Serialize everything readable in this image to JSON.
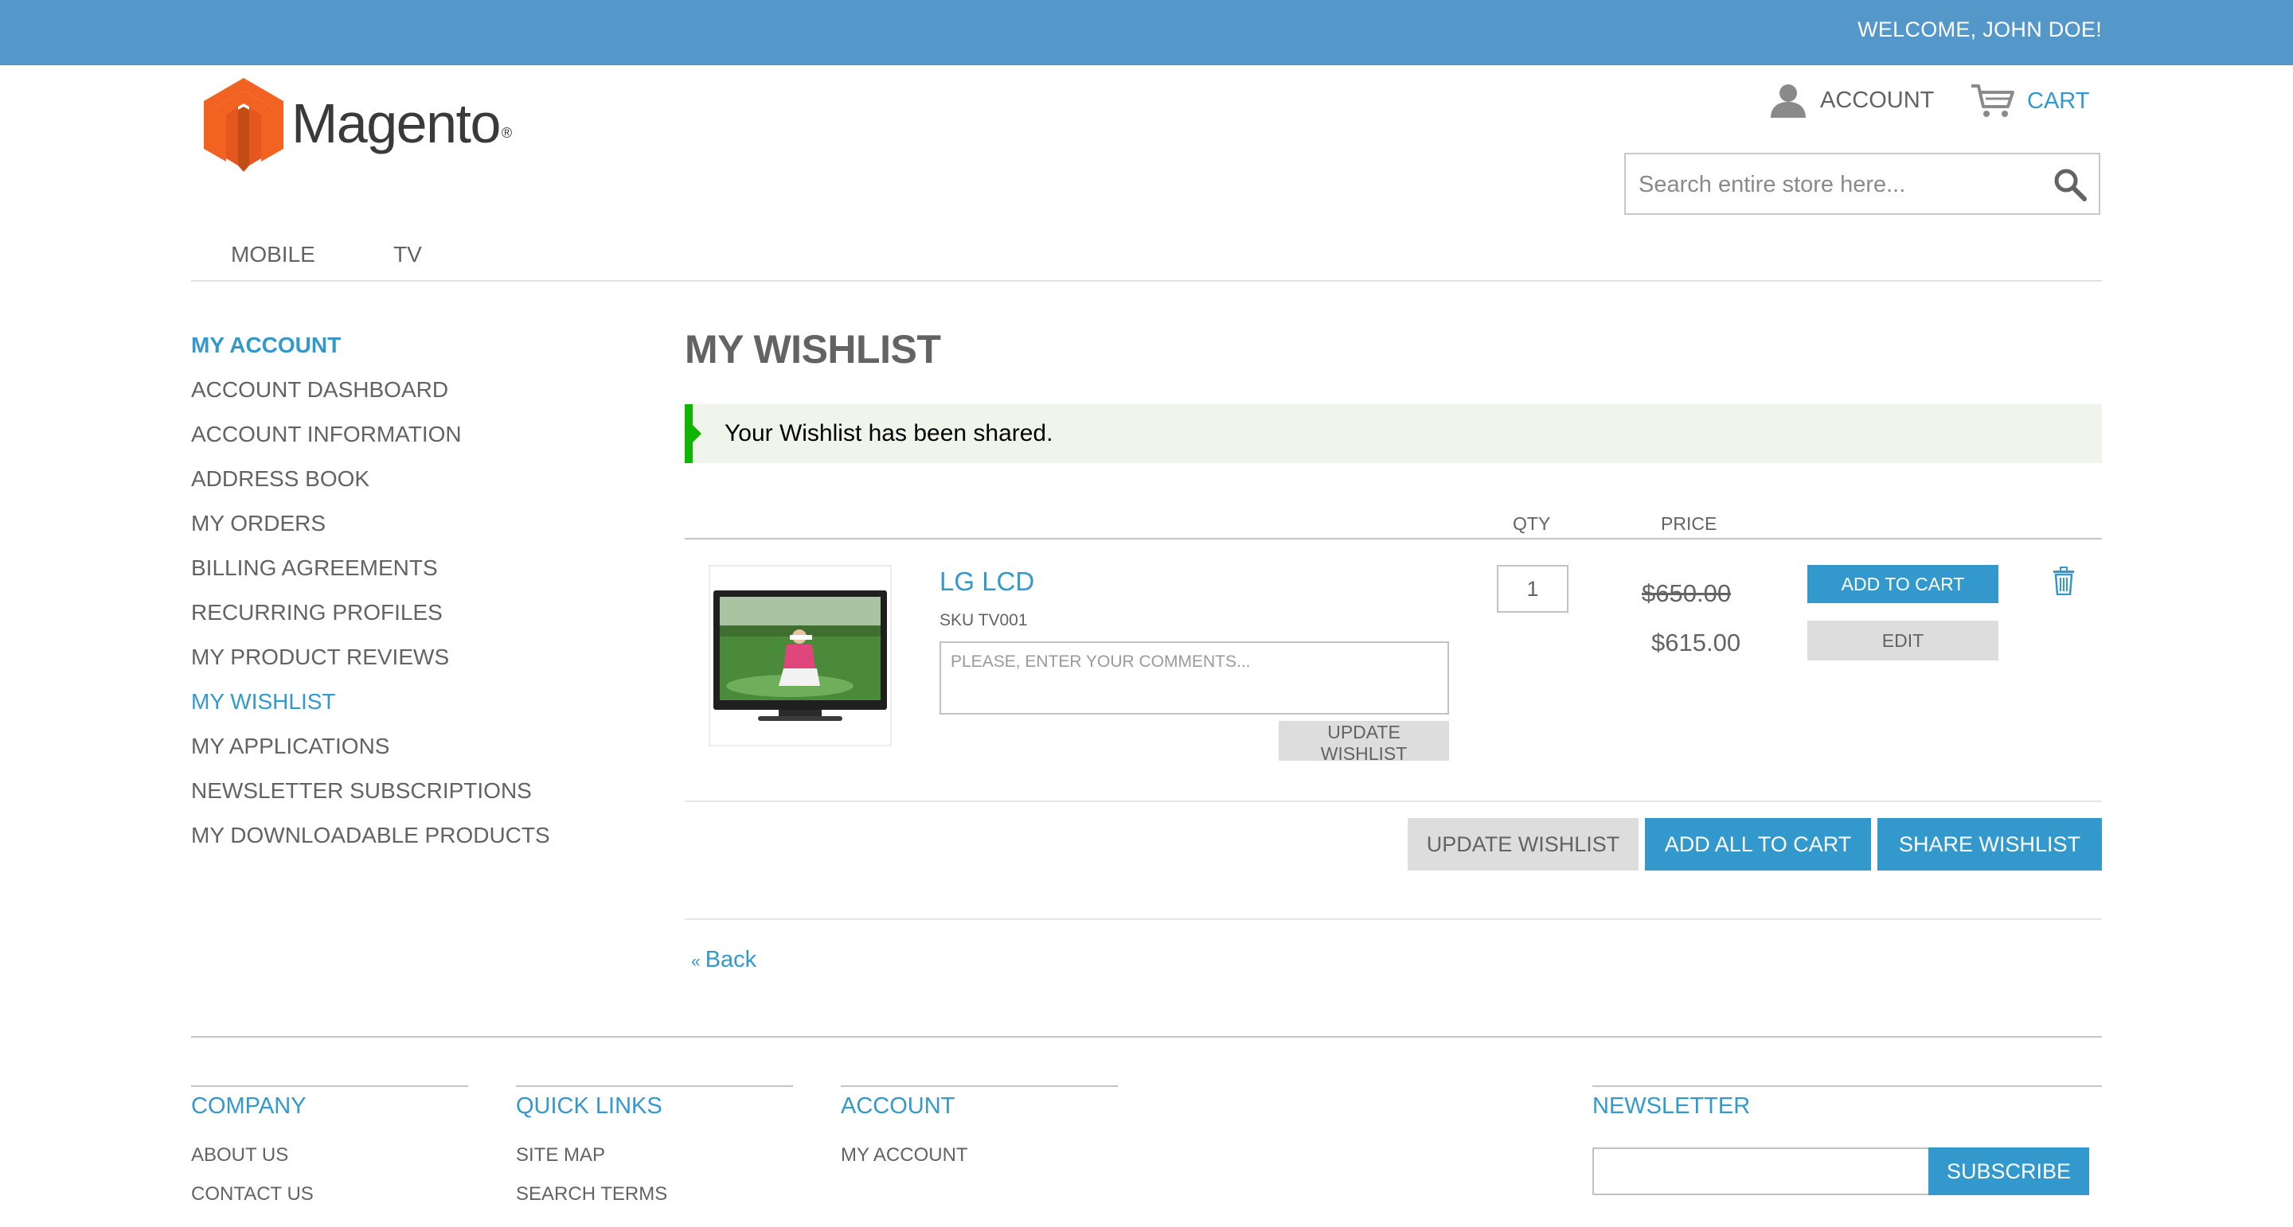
{
  "topbar": {
    "welcome": "WELCOME, JOHN DOE!"
  },
  "brand": {
    "name": "Magento",
    "reg_mark": "®",
    "logo_colors": [
      "#f26322",
      "#c24e16"
    ]
  },
  "header": {
    "account_label": "ACCOUNT",
    "cart_label": "CART",
    "search_placeholder": "Search entire store here..."
  },
  "nav": {
    "items": [
      "MOBILE",
      "TV"
    ]
  },
  "sidebar": {
    "title": "MY ACCOUNT",
    "items": [
      "ACCOUNT DASHBOARD",
      "ACCOUNT INFORMATION",
      "ADDRESS BOOK",
      "MY ORDERS",
      "BILLING AGREEMENTS",
      "RECURRING PROFILES",
      "MY PRODUCT REVIEWS",
      "MY WISHLIST",
      "MY APPLICATIONS",
      "NEWSLETTER SUBSCRIPTIONS",
      "MY DOWNLOADABLE PRODUCTS"
    ],
    "active_item": "MY WISHLIST"
  },
  "main": {
    "title": "MY WISHLIST",
    "success_message": "Your Wishlist has been shared.",
    "columns": {
      "qty": "QTY",
      "price": "PRICE"
    },
    "item": {
      "name": "LG LCD",
      "sku": "SKU TV001",
      "comment_placeholder": "PLEASE, ENTER YOUR COMMENTS...",
      "update_label": "UPDATE WISHLIST",
      "qty": "1",
      "old_price": "$650.00",
      "price": "$615.00",
      "add_to_cart_label": "ADD TO CART",
      "edit_label": "EDIT"
    },
    "actions": {
      "update": "UPDATE WISHLIST",
      "add_all": "ADD ALL TO CART",
      "share": "SHARE WISHLIST"
    },
    "back_arrow": "«",
    "back_label": "Back"
  },
  "footer": {
    "company": {
      "title": "COMPANY",
      "links": [
        "ABOUT US",
        "CONTACT US"
      ]
    },
    "quick_links": {
      "title": "QUICK LINKS",
      "links": [
        "SITE MAP",
        "SEARCH TERMS"
      ]
    },
    "account": {
      "title": "ACCOUNT",
      "links": [
        "MY ACCOUNT"
      ]
    },
    "newsletter": {
      "title": "NEWSLETTER",
      "subscribe_label": "SUBSCRIBE"
    }
  },
  "colors": {
    "brand_blue": "#3399cc",
    "topbar": "#5497c9",
    "success_border": "#11b400"
  }
}
